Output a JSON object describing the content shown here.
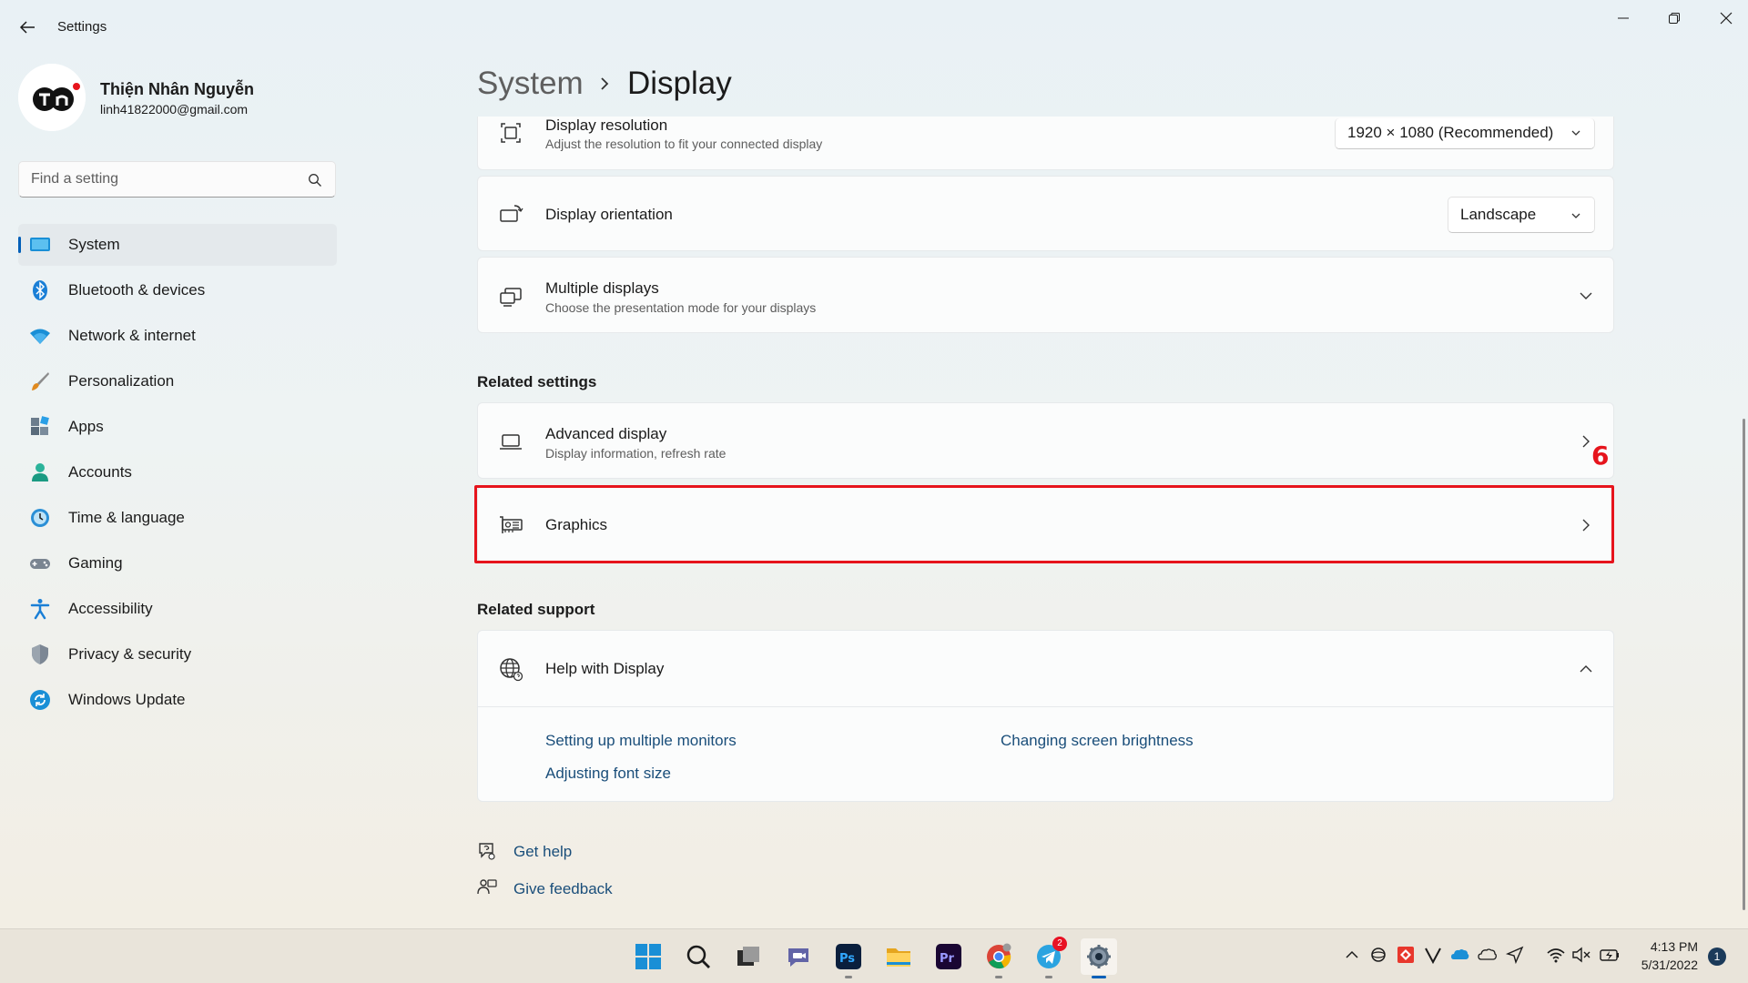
{
  "app": {
    "title": "Settings"
  },
  "profile": {
    "initials": "TN",
    "name": "Thiện Nhân Nguyễn",
    "email": "linh41822000@gmail.com"
  },
  "search": {
    "placeholder": "Find a setting"
  },
  "sidebar": {
    "items": [
      {
        "label": "System",
        "icon": "system-icon",
        "active": true
      },
      {
        "label": "Bluetooth & devices",
        "icon": "bluetooth-icon"
      },
      {
        "label": "Network & internet",
        "icon": "wifi-icon"
      },
      {
        "label": "Personalization",
        "icon": "brush-icon"
      },
      {
        "label": "Apps",
        "icon": "apps-icon"
      },
      {
        "label": "Accounts",
        "icon": "accounts-icon"
      },
      {
        "label": "Time & language",
        "icon": "time-language-icon"
      },
      {
        "label": "Gaming",
        "icon": "gamepad-icon"
      },
      {
        "label": "Accessibility",
        "icon": "accessibility-icon"
      },
      {
        "label": "Privacy & security",
        "icon": "shield-icon"
      },
      {
        "label": "Windows Update",
        "icon": "update-icon"
      }
    ]
  },
  "header": {
    "crumb_parent": "System",
    "crumb_current": "Display"
  },
  "display_settings": {
    "resolution": {
      "title": "Display resolution",
      "subtitle": "Adjust the resolution to fit your connected display",
      "value": "1920 × 1080 (Recommended)"
    },
    "orientation": {
      "title": "Display orientation",
      "value": "Landscape"
    },
    "multiple": {
      "title": "Multiple displays",
      "subtitle": "Choose the presentation mode for your displays"
    }
  },
  "related_settings": {
    "heading": "Related settings",
    "advanced": {
      "title": "Advanced display",
      "subtitle": "Display information, refresh rate"
    },
    "graphics": {
      "title": "Graphics"
    }
  },
  "annotation": {
    "step": "6",
    "color": "#e6141c"
  },
  "related_support": {
    "heading": "Related support",
    "help": {
      "title": "Help with Display"
    },
    "links": [
      "Setting up multiple monitors",
      "Changing screen brightness",
      "Adjusting font size"
    ]
  },
  "footer": {
    "get_help": "Get help",
    "give_feedback": "Give feedback"
  },
  "taskbar": {
    "apps": [
      "start-icon",
      "search-icon",
      "task-view-icon",
      "teams-chat-icon",
      "photoshop-icon",
      "file-explorer-icon",
      "premiere-icon",
      "chrome-icon",
      "telegram-icon",
      "settings-icon"
    ],
    "telegram_badge": "2",
    "clock": {
      "time": "4:13 PM",
      "date": "5/31/2022"
    },
    "notifications": "1"
  },
  "colors": {
    "accent": "#005fb8",
    "link": "#1a4e7a",
    "highlight": "#e6141c"
  }
}
